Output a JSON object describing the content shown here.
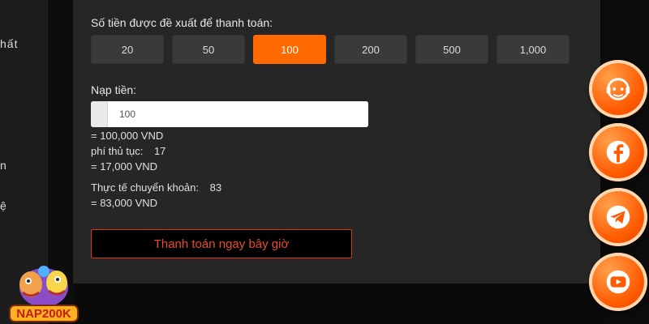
{
  "sidebar": {
    "fragments": [
      "hất",
      "n",
      "ệ"
    ]
  },
  "form": {
    "suggested_title": "Số tiền được đề xuất để thanh toán:",
    "amounts": [
      "20",
      "50",
      "100",
      "200",
      "500",
      "1,000"
    ],
    "selected_amount": "100",
    "deposit_label": "Nạp tiền:",
    "deposit_value": "100",
    "deposit_equiv": "= 100,000 VND",
    "fee_label": "phí thủ tục:",
    "fee_value": "17",
    "fee_equiv": "= 17,000 VND",
    "actual_label": "Thực tế chuyển khoản:",
    "actual_value": "83",
    "actual_equiv": "= 83,000 VND",
    "pay_button": "Thanh toán ngay bây giờ"
  },
  "social": [
    "support-icon",
    "facebook-icon",
    "telegram-icon",
    "youtube-icon"
  ],
  "colors": {
    "accent": "#ff6a00",
    "pay_border": "#d9381e",
    "panel": "#262626"
  },
  "mascot": {
    "brand": "NAP200K"
  }
}
